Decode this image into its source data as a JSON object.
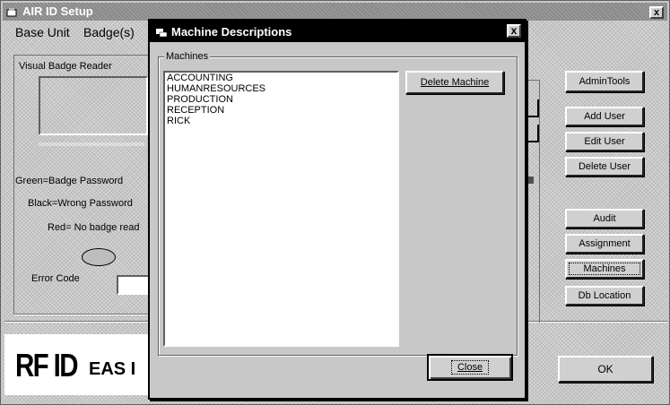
{
  "main": {
    "title": "AIR ID Setup",
    "close": "x",
    "menu": [
      "Base Unit",
      "Badge(s)"
    ],
    "visual_reader": {
      "label": "Visual Badge Reader"
    },
    "legend": [
      "Green=Badge Password",
      "Black=Wrong Password",
      "Red= No badge read"
    ],
    "error_code_label": "Error Code",
    "buttons": {
      "admin_tools": "AdminTools",
      "add_user": "Add User",
      "edit_user": "Edit User",
      "delete_user": "Delete User",
      "audit": "Audit",
      "assignment": "Assignment",
      "machines": "Machines",
      "db_location": "Db Location",
      "ok": "OK"
    },
    "logo": {
      "big": "RF ID",
      "small": "EAS I"
    }
  },
  "modal": {
    "title": "Machine Descriptions",
    "close": "x",
    "group_label": "Machines",
    "machines": [
      "ACCOUNTING",
      "HUMANRESOURCES",
      "PRODUCTION",
      "RECEPTION",
      "RICK"
    ],
    "delete_button": "Delete Machine",
    "close_button": "Close"
  }
}
